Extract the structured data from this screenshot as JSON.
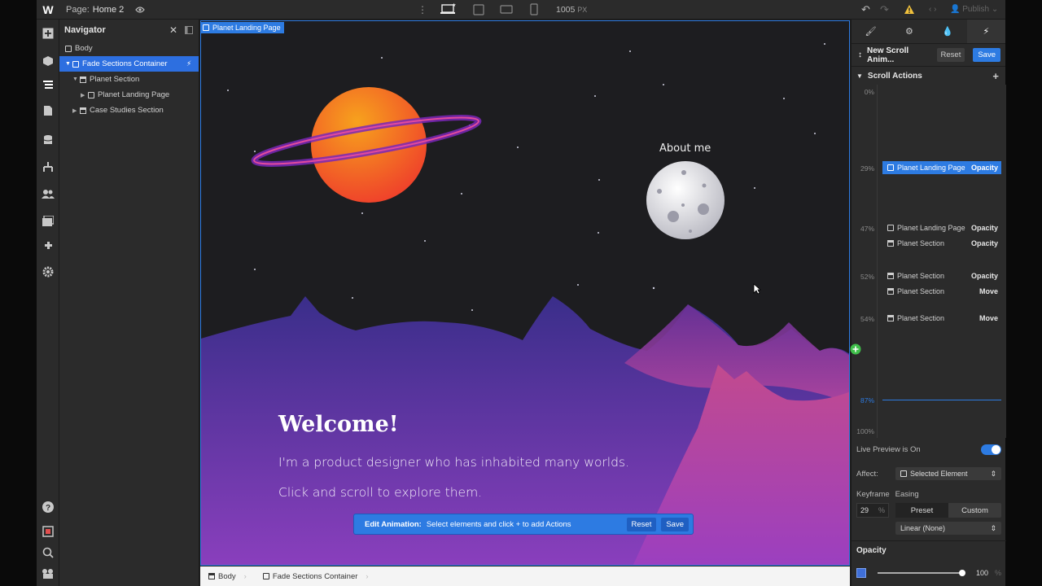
{
  "topbar": {
    "logo": "W",
    "page_label": "Page:",
    "page_name": "Home 2",
    "width_readout": "1005",
    "width_unit": "PX",
    "publish_label": "Publish"
  },
  "navigator": {
    "title": "Navigator",
    "items": [
      {
        "label": "Body"
      },
      {
        "label": "Fade Sections Container"
      },
      {
        "label": "Planet Section"
      },
      {
        "label": "Planet Landing Page"
      },
      {
        "label": "Case Studies Section"
      }
    ]
  },
  "canvas": {
    "selected_tag": "Planet Landing Page",
    "welcome": "Welcome!",
    "line1": "I'm a product designer who has inhabited many worlds.",
    "line2": "Click and scroll to explore them.",
    "about": "About me"
  },
  "editbar": {
    "label": "Edit Animation:",
    "hint": "Select elements and click + to add Actions",
    "reset": "Reset",
    "save": "Save"
  },
  "breadcrumb": {
    "items": [
      "Body",
      "Fade Sections Container"
    ]
  },
  "right_panel": {
    "animation_name": "New Scroll Anim...",
    "reset": "Reset",
    "save": "Save",
    "scroll_actions": "Scroll Actions",
    "marks": {
      "p0": "0%",
      "p29": "29%",
      "p47": "47%",
      "p52": "52%",
      "p54": "54%",
      "p87": "87%",
      "p100": "100%"
    },
    "keyframes": [
      {
        "target": "Planet Landing Page",
        "action": "Opacity"
      },
      {
        "target": "Planet Landing Page",
        "action": "Opacity"
      },
      {
        "target": "Planet Section",
        "action": "Opacity"
      },
      {
        "target": "Planet Section",
        "action": "Opacity"
      },
      {
        "target": "Planet Section",
        "action": "Move"
      },
      {
        "target": "Planet Section",
        "action": "Move"
      }
    ],
    "live_preview": "Live Preview is On",
    "affect_label": "Affect:",
    "affect_value": "Selected Element",
    "keyframe_label": "Keyframe",
    "easing_label": "Easing",
    "keyframe_value": "29",
    "keyframe_unit": "%",
    "preset": "Preset",
    "custom": "Custom",
    "easing_value": "Linear (None)",
    "opacity_label": "Opacity",
    "opacity_value": "100",
    "opacity_unit": "%",
    "opacity_level": 1.0
  },
  "colors": {
    "accent": "#2d7be2",
    "planet": "#f07a1e",
    "ring": "#8a2fd0",
    "mountains_back": "#3c2d8f",
    "mountains_front": "#c0409a"
  }
}
